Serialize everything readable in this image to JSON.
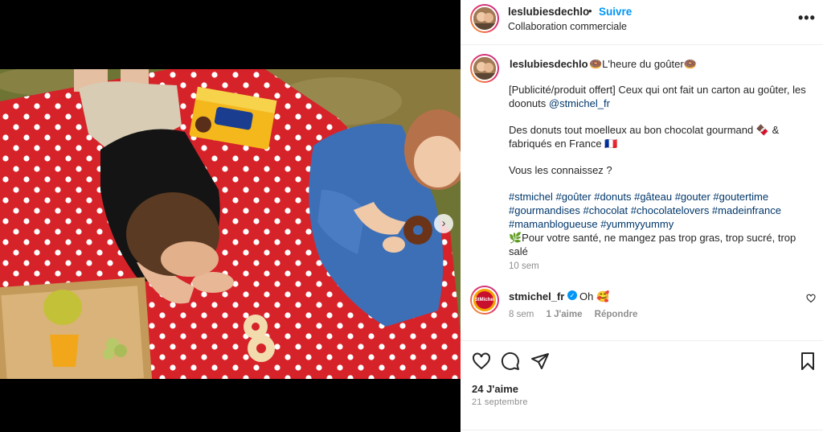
{
  "header": {
    "username": "leslubiesdechlo",
    "separator": "•",
    "follow_label": "Suivre",
    "subtitle": "Collaboration commerciale",
    "more_label": "•••"
  },
  "caption": {
    "username": "leslubiesdechlo",
    "title": "🍩L'heure du goûter🍩",
    "para1_text": "[Publicité/produit offert] Ceux qui ont fait un carton au goûter, les doonuts ",
    "para1_mention": "@stmichel_fr",
    "para2": "Des donuts tout moelleux au bon chocolat gourmand 🍫 & fabriqués en France 🇫🇷",
    "para3": "Vous les connaissez ?",
    "hashtags": "#stmichel #goûter #donuts #gâteau #gouter #goutertime #gourmandises #chocolat #chocolatelovers #madeinfrance #mamanblogueuse #yummyyummy",
    "health": "🌿Pour votre santé, ne mangez pas trop gras, trop sucré, trop salé",
    "time": "10 sem"
  },
  "comment": {
    "username": "stmichel_fr",
    "verified_mark": "✓",
    "text": "Oh 🥰",
    "time": "8 sem",
    "likes": "1 J'aime",
    "reply_label": "Répondre",
    "avatar_text": "StMichel"
  },
  "actions": {
    "likes": "24 J'aime",
    "date": "21 septembre"
  },
  "media": {
    "next_label": "›"
  },
  "colors": {
    "link": "#00376b",
    "follow": "#0095f6",
    "blanket": "#d6232a"
  }
}
